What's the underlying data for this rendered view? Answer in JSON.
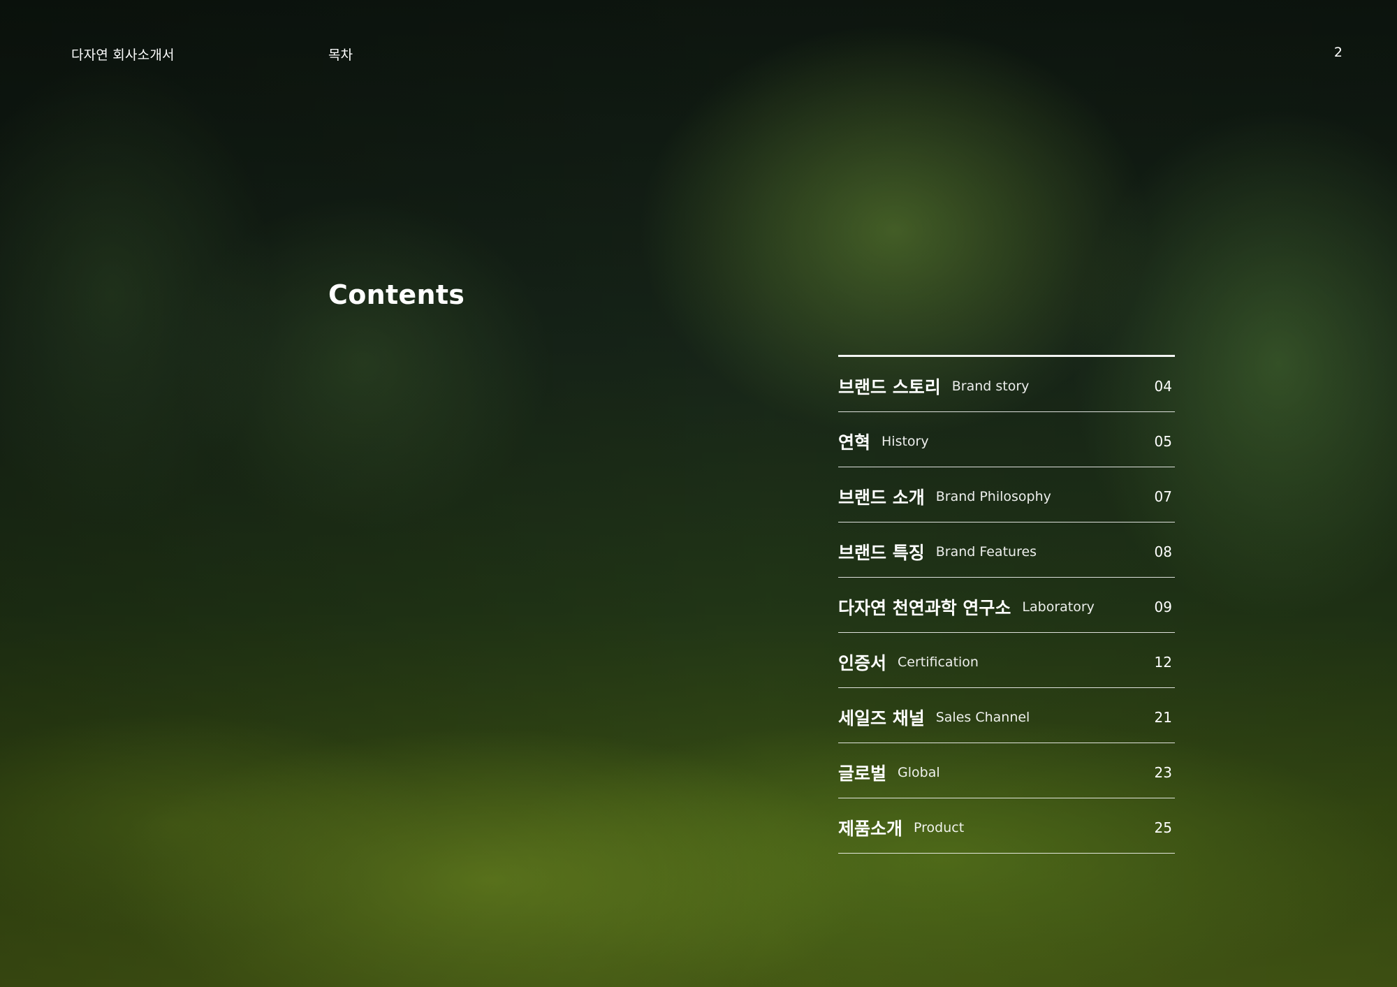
{
  "header": {
    "company": "다자연 회사소개서",
    "section": "목차",
    "page_number": "2"
  },
  "title": "Contents",
  "toc": {
    "items": [
      {
        "ko": "브랜드 스토리",
        "en": "Brand story",
        "page": "04"
      },
      {
        "ko": "연혁",
        "en": "History",
        "page": "05"
      },
      {
        "ko": "브랜드 소개",
        "en": "Brand Philosophy",
        "page": "07"
      },
      {
        "ko": "브랜드 특징",
        "en": "Brand Features",
        "page": "08"
      },
      {
        "ko": "다자연 천연과학 연구소",
        "en": "Laboratory",
        "page": "09"
      },
      {
        "ko": "인증서",
        "en": "Certification",
        "page": "12"
      },
      {
        "ko": "세일즈 채널",
        "en": "Sales Channel",
        "page": "21"
      },
      {
        "ko": "글로벌",
        "en": "Global",
        "page": "23"
      },
      {
        "ko": "제품소개",
        "en": "Product",
        "page": "25"
      }
    ]
  }
}
